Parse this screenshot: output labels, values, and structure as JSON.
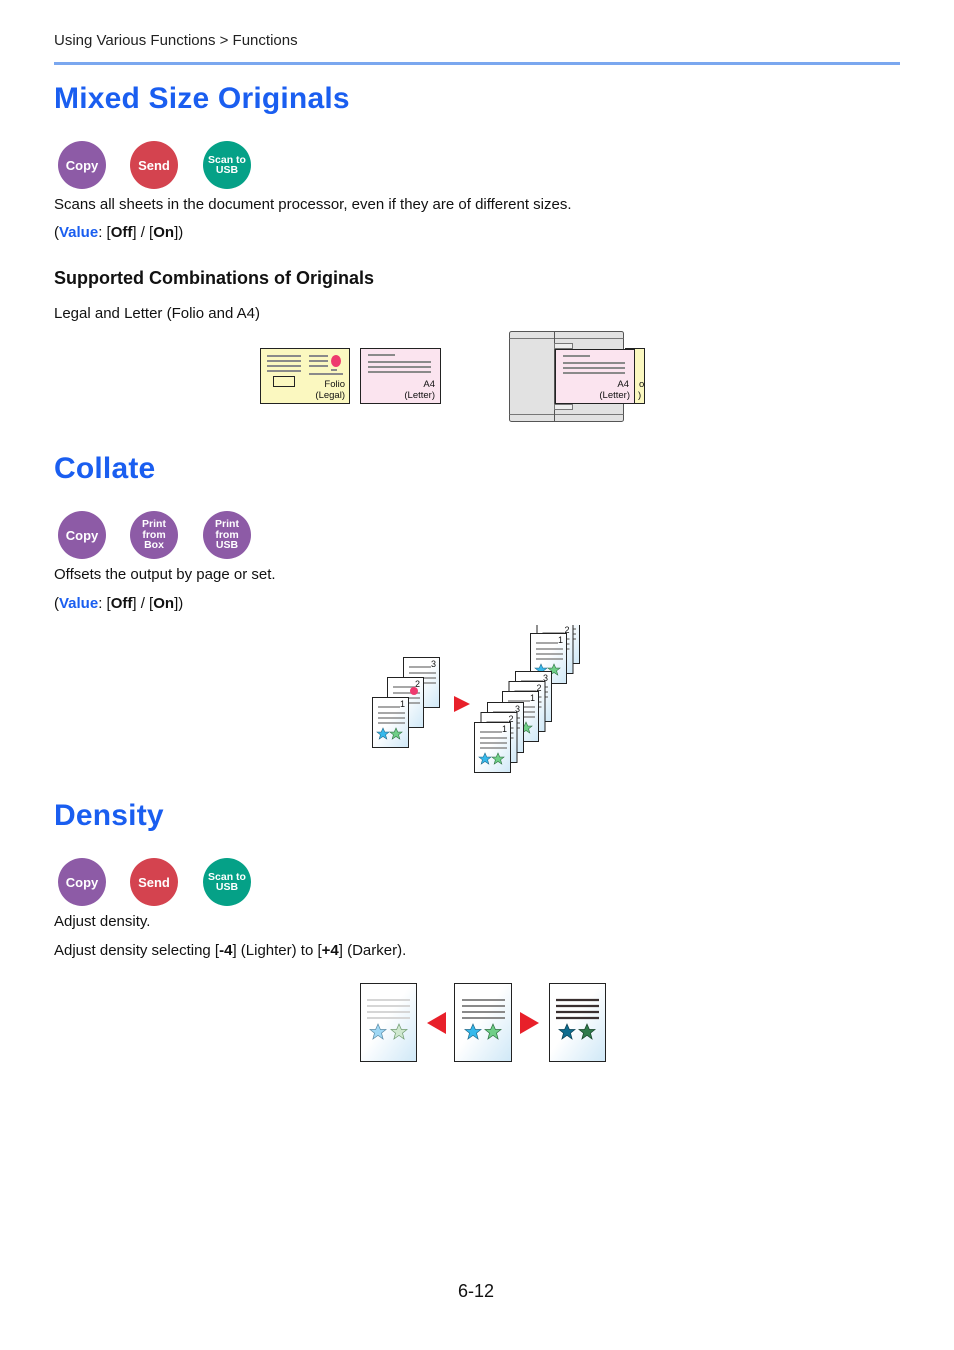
{
  "header": {
    "breadcrumb": "Using Various Functions > Functions"
  },
  "sections": [
    {
      "title": "Mixed Size Originals",
      "badges": [
        {
          "label_lines": [
            "Copy"
          ],
          "color": "#8d5ba6"
        },
        {
          "label_lines": [
            "Send"
          ],
          "color": "#d4434f"
        },
        {
          "label_lines": [
            "Scan to",
            "USB"
          ],
          "color": "#05a187"
        }
      ],
      "description": "Scans all sheets in the document processor, even if they are of different sizes.",
      "value_label": "Value",
      "value_options": [
        "Off",
        "On"
      ],
      "subheading": "Supported Combinations of Originals",
      "combination": "Legal and Letter (Folio and A4)",
      "illustration": {
        "sheet1": {
          "line1": "Folio",
          "line2": "(Legal)",
          "color": "#fbf8c0"
        },
        "sheet2": {
          "line1": "A4",
          "line2": "(Letter)",
          "color": "#fbe4ef"
        },
        "stacked_front": {
          "line1": "A4",
          "line2": "(Letter)"
        },
        "stacked_back_partial": {
          "line1": "o",
          "line2": ")"
        }
      }
    },
    {
      "title": "Collate",
      "badges": [
        {
          "label_lines": [
            "Copy"
          ],
          "color": "#8d5ba6"
        },
        {
          "label_lines": [
            "Print from",
            "Box"
          ],
          "color": "#8d5ba6"
        },
        {
          "label_lines": [
            "Print from",
            "USB"
          ],
          "color": "#8d5ba6"
        }
      ],
      "description": "Offsets the output by page or set.",
      "value_label": "Value",
      "value_options": [
        "Off",
        "On"
      ],
      "illustration": {
        "input_pages": [
          "1",
          "2",
          "3"
        ],
        "output_sets": 3,
        "arrow_color": "#e8202a"
      }
    },
    {
      "title": "Density",
      "badges": [
        {
          "label_lines": [
            "Copy"
          ],
          "color": "#8d5ba6"
        },
        {
          "label_lines": [
            "Send"
          ],
          "color": "#d4434f"
        },
        {
          "label_lines": [
            "Scan to",
            "USB"
          ],
          "color": "#05a187"
        }
      ],
      "description": "Adjust density.",
      "range_text": {
        "prefix": "Adjust density selecting [",
        "min": "-4",
        "mid1": "] (Lighter) to [",
        "max": "+4",
        "suffix": "] (Darker)."
      },
      "illustration": {
        "levels": [
          "lighter",
          "normal",
          "darker"
        ],
        "arrow_color": "#e8202a"
      }
    }
  ],
  "footer": {
    "page_number": "6-12"
  }
}
